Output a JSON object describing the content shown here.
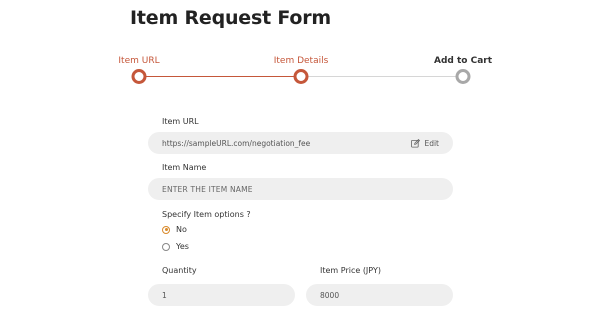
{
  "page": {
    "title": "Item Request Form"
  },
  "stepper": {
    "steps": [
      {
        "label": "Item URL",
        "state": "active"
      },
      {
        "label": "Item Details",
        "state": "active"
      },
      {
        "label": "Add to Cart",
        "state": "inactive"
      }
    ],
    "colors": {
      "active": "#c5573a",
      "inactive": "#a8a8a8"
    }
  },
  "form": {
    "item_url": {
      "label": "Item URL",
      "value": "https://sampleURL.com/negotiation_fee",
      "edit_label": "Edit",
      "edit_icon": "pencil-edit-icon"
    },
    "item_name": {
      "label": "Item Name",
      "placeholder": "ENTER THE ITEM NAME"
    },
    "options": {
      "question": "Specify Item options ?",
      "choices": [
        "No",
        "Yes"
      ],
      "selected": "No",
      "accent": "#d98a2b"
    },
    "quantity": {
      "label": "Quantity",
      "value": "1"
    },
    "price": {
      "label": "Item Price (JPY)",
      "value": "8000"
    }
  }
}
